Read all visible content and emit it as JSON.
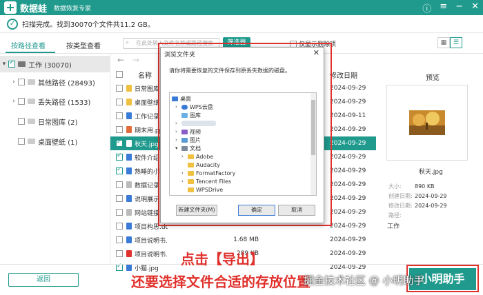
{
  "app": {
    "name": "数据蛙",
    "subtitle": "数据恢复专家"
  },
  "status": {
    "text": "扫描完成。找到30070个文件共11.2 GB。"
  },
  "tabs": [
    {
      "label": "按路径查看"
    },
    {
      "label": "按类型查看"
    }
  ],
  "search": {
    "placeholder": "在此处输入文件名称或路径搜索"
  },
  "filter_label": "筛选器",
  "show_deleted_label": "仅显示删除项",
  "tree": [
    {
      "label": "工作 (30070)"
    },
    {
      "label": "其他路径 (28493)"
    },
    {
      "label": "丢失路径 (1533)"
    },
    {
      "label": "日常图库 (2)"
    },
    {
      "label": "桌面壁纸 (1)"
    }
  ],
  "columns": {
    "name": "名称",
    "modified": "修改日期"
  },
  "files": [
    {
      "name": "日常图库",
      "size": "",
      "date": "2024-09-29",
      "checked": false,
      "color": "#f0c140"
    },
    {
      "name": "桌面壁纸",
      "size": "",
      "date": "2024-09-29",
      "checked": false,
      "color": "#f0c140"
    },
    {
      "name": "工作记录",
      "size": "",
      "date": "2024-09-11",
      "checked": false,
      "color": "#3b7bd8"
    },
    {
      "name": "期末用.ppt",
      "size": "",
      "date": "2024-09-29",
      "checked": false,
      "color": "#e06c3c"
    },
    {
      "name": "秋天.jpg",
      "size": "",
      "date": "2024-09-29",
      "checked": true,
      "color": "#ffffff"
    },
    {
      "name": "软件介绍",
      "size": "",
      "date": "2024-09-29",
      "checked": true,
      "color": "#3b7bd8"
    },
    {
      "name": "熟睡的小猫",
      "size": "",
      "date": "2024-09-29",
      "checked": true,
      "color": "#3b7bd8"
    },
    {
      "name": "数据记录",
      "size": "",
      "date": "2024-09-29",
      "checked": false,
      "color": "#bbbbbb"
    },
    {
      "name": "说明展示",
      "size": "",
      "date": "2024-09-29",
      "checked": false,
      "color": "#3b7bd8"
    },
    {
      "name": "网站链接",
      "size": "",
      "date": "2024-09-29",
      "checked": false,
      "color": "#bbbbbb"
    },
    {
      "name": "项目构思.docx",
      "size": "",
      "date": "2024-09-29",
      "checked": false,
      "color": "#3b7bd8"
    },
    {
      "name": "项目说明书.do...",
      "size": "1.68 MB",
      "date": "2024-09-29",
      "checked": false,
      "color": "#3b7bd8"
    },
    {
      "name": "项目说明书.pdf",
      "size": "289 KB",
      "date": "2024-09-29",
      "checked": false,
      "color": "#e0312c"
    },
    {
      "name": "小猫.jpg",
      "size": "",
      "date": "2024-09-29",
      "checked": true,
      "color": "#3b7bd8"
    }
  ],
  "preview": {
    "title": "预览",
    "filename": "秋天.jpg",
    "meta": [
      {
        "k": "大小:",
        "v": "890 KB"
      },
      {
        "k": "创建日期:",
        "v": "2024-09-29"
      },
      {
        "k": "修改日期:",
        "v": "2024-09-29"
      },
      {
        "k": "路径:",
        "v": ""
      }
    ],
    "path": "工作"
  },
  "dialog": {
    "title": "浏览文件夹",
    "message": "请你将需要恢复的文件保存到原丢失数据的磁盘。",
    "tree": [
      "桌面",
      "WPS云盘",
      "图库",
      "视频",
      "图片",
      "文档",
      "Adobe",
      "Audacity",
      "FormatFactory",
      "Tencent Files",
      "WPSDrive"
    ],
    "new_folder": "新建文件夹(M)",
    "ok": "确定",
    "cancel": "取消"
  },
  "back_label": "返回",
  "export_label": "小明助手",
  "annotations": {
    "line1": "点击【导出】",
    "line2": "还要选择文件合适的存放位置"
  },
  "watermark": "掘金技术社区 @ 小明助手",
  "colors": {
    "accent": "#1f9a8d",
    "annotation": "#e0312c"
  }
}
